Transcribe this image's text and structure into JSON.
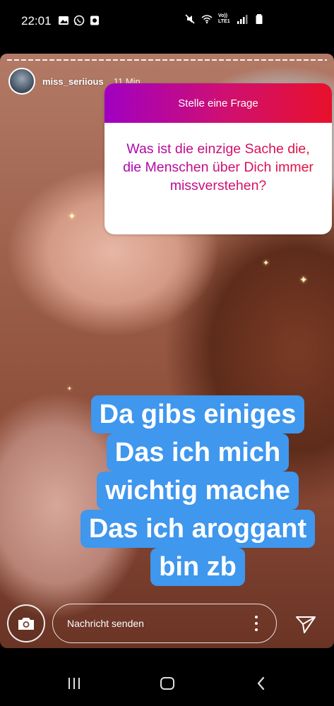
{
  "status_bar": {
    "time": "22:01",
    "left_icons": [
      "image-icon",
      "whatsapp-icon",
      "app-icon"
    ],
    "right_icons": [
      "mute-icon",
      "wifi-icon",
      "volte-lte-icon",
      "signal-icon",
      "battery-icon"
    ],
    "network_label": "Vo)) LTE1"
  },
  "story": {
    "username": "miss_seriious",
    "time_ago": "11 Min.",
    "question": {
      "header": "Stelle eine Frage",
      "text": "Was ist die einzige Sache die, die Menschen über Dich immer missverstehen?",
      "gradient": [
        "#a100c2",
        "#e8102a"
      ]
    },
    "answer_lines": [
      "Da gibs einiges",
      "Das ich mich",
      "wichtig mache",
      "Das ich aroggant",
      "bin zb"
    ],
    "answer_bg_color": "#3f97ee",
    "reply": {
      "placeholder": "Nachricht senden"
    }
  },
  "nav": {
    "items": [
      "recent-apps-icon",
      "home-icon",
      "back-icon"
    ]
  }
}
